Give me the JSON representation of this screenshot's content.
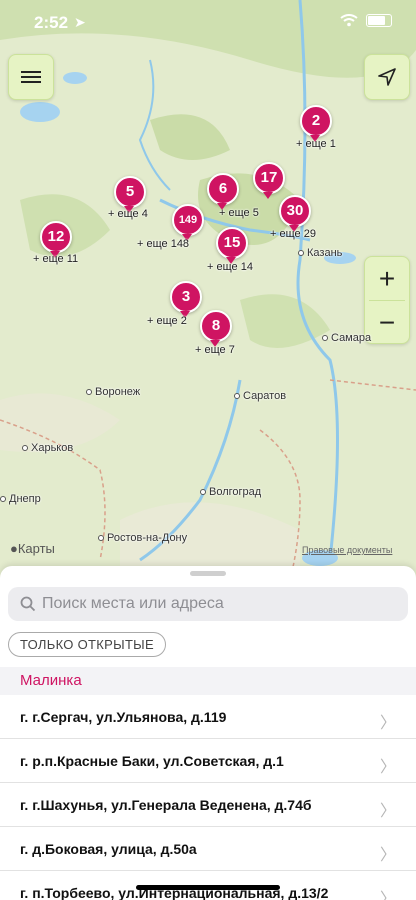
{
  "status_bar": {
    "time": "2:52"
  },
  "map": {
    "pins": [
      {
        "count": "2",
        "label": "+ еще 1"
      },
      {
        "count": "5",
        "label": "+ еще 4"
      },
      {
        "count": "6",
        "label": "+ еще 5"
      },
      {
        "count": "17",
        "label": ""
      },
      {
        "count": "149",
        "label": "+ еще 148"
      },
      {
        "count": "30",
        "label": "+ еще 29"
      },
      {
        "count": "12",
        "label": "+ еще 11"
      },
      {
        "count": "15",
        "label": "+ еще 14"
      },
      {
        "count": "3",
        "label": "+ еще 2"
      },
      {
        "count": "8",
        "label": "+ еще 7"
      }
    ],
    "cities": [
      "Казань",
      "Самара",
      "Воронеж",
      "Саратов",
      "Харьков",
      "Днепр",
      "Волгоград",
      "Ростов-на-Дону"
    ],
    "brand": "Карты",
    "legal": "Правовые документы",
    "zoom_in": "+",
    "zoom_out": "−"
  },
  "sheet": {
    "search_placeholder": "Поиск места или адреса",
    "filter_label": "ТОЛЬКО ОТКРЫТЫЕ",
    "section_title": "Малинка",
    "rows": [
      "г. г.Сергач, ул.Ульянова, д.119",
      "г. р.п.Красные Баки, ул.Советская, д.1",
      "г. г.Шахунья, ул.Генерала Веденена, д.74б",
      "г. д.Боковая, улица, д.50а",
      "г. п.Торбеево, ул.Интернациональная, д.13/2"
    ]
  },
  "colors": {
    "accent": "#cf1462",
    "map_land": "#dfe8c8",
    "control_bg": "#e6f3c4"
  }
}
